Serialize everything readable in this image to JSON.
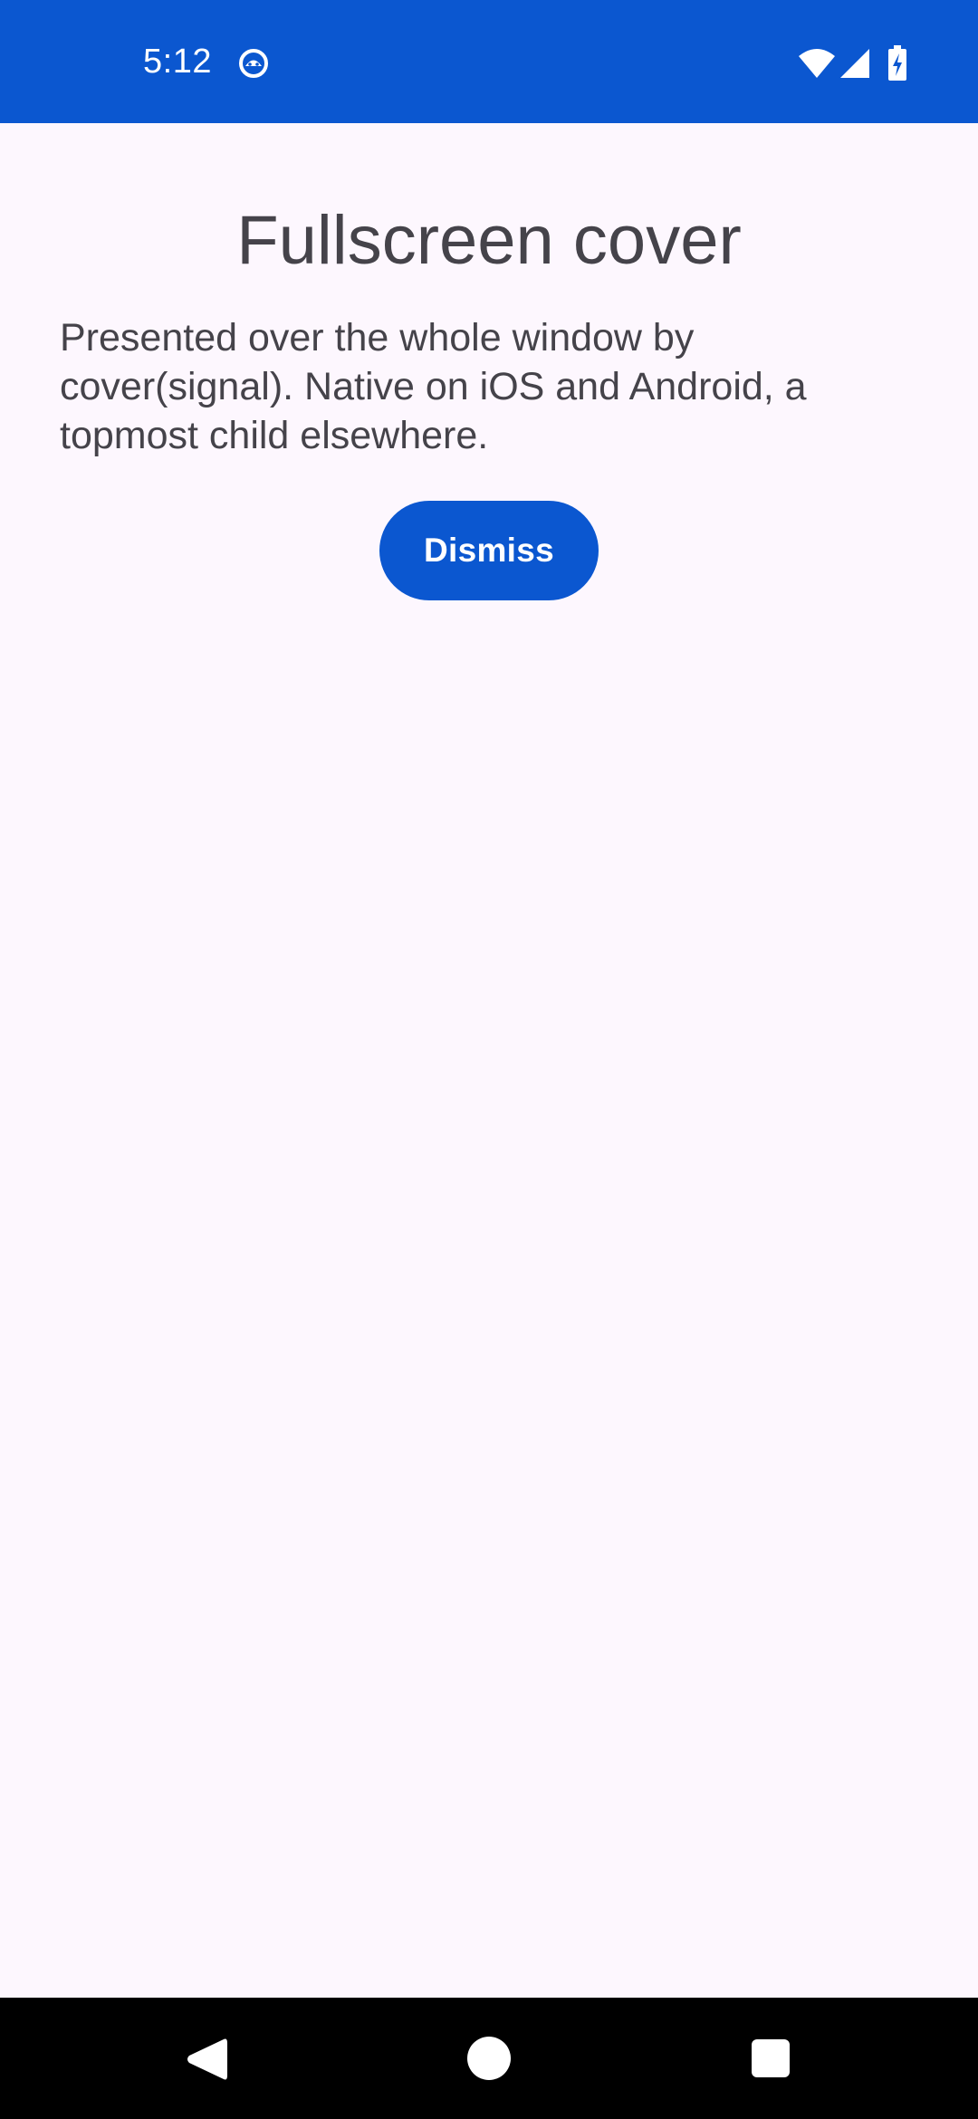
{
  "status_bar": {
    "time": "5:12",
    "background_color": "#0b57d0",
    "icons": [
      "notification-icon",
      "wifi-icon",
      "cell-signal-icon",
      "battery-charging-icon"
    ]
  },
  "screen": {
    "title": "Fullscreen cover",
    "description": "Presented over the whole window by cover(signal). Native on iOS and Android, a topmost child elsewhere.",
    "dismiss_label": "Dismiss",
    "accent_color": "#0b57d0",
    "background_color": "#fdf7fe"
  },
  "nav_bar": {
    "buttons": [
      "back-icon",
      "home-icon",
      "recents-icon"
    ]
  }
}
